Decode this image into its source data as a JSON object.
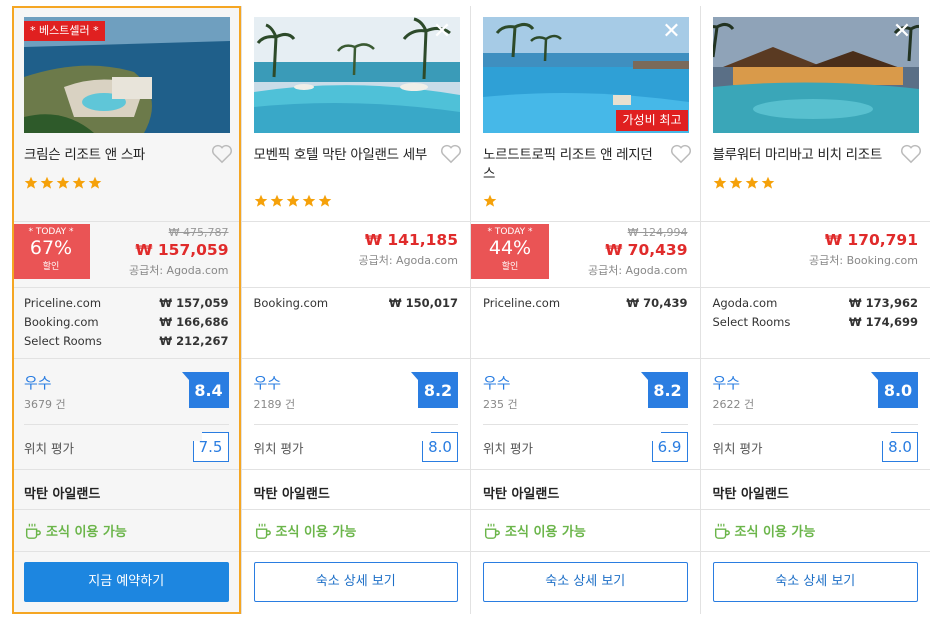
{
  "colors": {
    "accent": "#2a7de1",
    "price": "#e02b2b",
    "deal": "#ea5455",
    "highlight": "#f5a623",
    "breakfast": "#6bb54a"
  },
  "hotels": [
    {
      "ribbon": "* 베스트셀러 *",
      "tag": "",
      "name": "크림슨 리조트 앤 스파",
      "stars": 5,
      "deal": {
        "today": "* TODAY *",
        "pct": "67%",
        "off": "할인"
      },
      "orig_price": "₩ 475,787",
      "price": "₩ 157,059",
      "supplier": "공급처: Agoda.com",
      "others": [
        {
          "site": "Priceline.com",
          "price": "₩ 157,059"
        },
        {
          "site": "Booking.com",
          "price": "₩ 166,686"
        },
        {
          "site": "Select Rooms",
          "price": "₩ 212,267"
        }
      ],
      "rating_word": "우수",
      "review_count": "3679 건",
      "score": "8.4",
      "location_label": "위치 평가",
      "location_score": "7.5",
      "area": "막탄 아일랜드",
      "breakfast": "조식 이용 가능",
      "button": "지금 예약하기"
    },
    {
      "ribbon": "",
      "tag": "",
      "name": "모벤픽 호텔 막탄 아일랜드 세부",
      "stars": 5,
      "deal": null,
      "orig_price": "",
      "price": "₩ 141,185",
      "supplier": "공급처: Agoda.com",
      "others": [
        {
          "site": "Booking.com",
          "price": "₩ 150,017"
        }
      ],
      "rating_word": "우수",
      "review_count": "2189 건",
      "score": "8.2",
      "location_label": "위치 평가",
      "location_score": "8.0",
      "area": "막탄 아일랜드",
      "breakfast": "조식 이용 가능",
      "button": "숙소 상세 보기"
    },
    {
      "ribbon": "",
      "tag": "가성비 최고",
      "name": "노르드트로픽 리조트 앤 레지던스",
      "stars": 1,
      "deal": {
        "today": "* TODAY *",
        "pct": "44%",
        "off": "할인"
      },
      "orig_price": "₩ 124,994",
      "price": "₩ 70,439",
      "supplier": "공급처: Agoda.com",
      "others": [
        {
          "site": "Priceline.com",
          "price": "₩ 70,439"
        }
      ],
      "rating_word": "우수",
      "review_count": "235 건",
      "score": "8.2",
      "location_label": "위치 평가",
      "location_score": "6.9",
      "area": "막탄 아일랜드",
      "breakfast": "조식 이용 가능",
      "button": "숙소 상세 보기"
    },
    {
      "ribbon": "",
      "tag": "",
      "name": "블루워터 마리바고 비치 리조트",
      "stars": 4,
      "deal": null,
      "orig_price": "",
      "price": "₩ 170,791",
      "supplier": "공급처: Booking.com",
      "others": [
        {
          "site": "Agoda.com",
          "price": "₩ 173,962"
        },
        {
          "site": "Select Rooms",
          "price": "₩ 174,699"
        }
      ],
      "rating_word": "우수",
      "review_count": "2622 건",
      "score": "8.0",
      "location_label": "위치 평가",
      "location_score": "8.0",
      "area": "막탄 아일랜드",
      "breakfast": "조식 이용 가능",
      "button": "숙소 상세 보기"
    }
  ]
}
